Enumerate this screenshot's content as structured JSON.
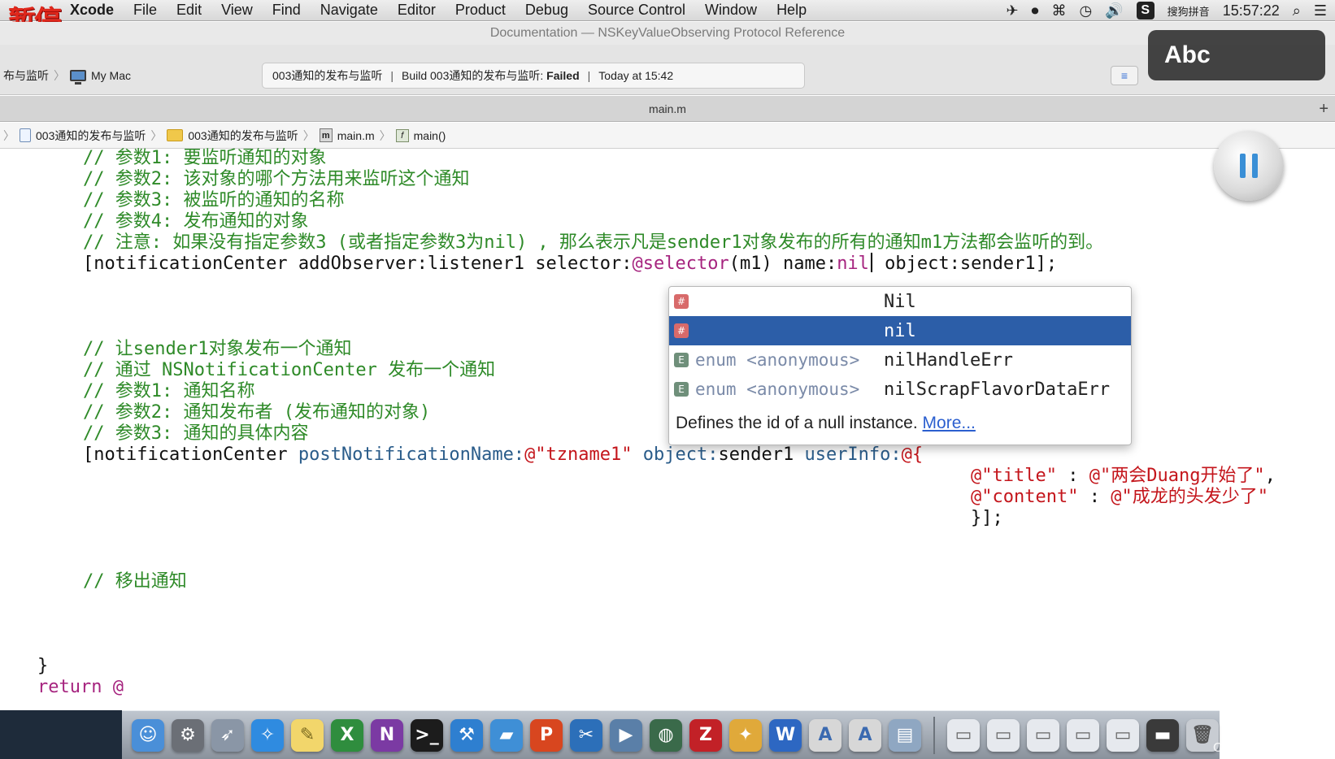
{
  "overlay": {
    "pause_label": "暂停",
    "ime_hud": "Abc"
  },
  "menubar": {
    "app": "Xcode",
    "items": [
      "File",
      "Edit",
      "View",
      "Find",
      "Navigate",
      "Editor",
      "Product",
      "Debug",
      "Source Control",
      "Window",
      "Help"
    ],
    "ime": "搜狗拼音",
    "clock": "15:57:22"
  },
  "window": {
    "title": "Documentation — NSKeyValueObserving Protocol Reference"
  },
  "toolbar": {
    "scheme": "布与监听",
    "destination": "My Mac",
    "activity": {
      "project": "003通知的发布与监听",
      "build_prefix": "Build 003通知的发布与监听:",
      "build_status": "Failed",
      "time": "Today at 15:42"
    }
  },
  "tab": {
    "title": "main.m",
    "add": "+"
  },
  "jumpbar": [
    "003通知的发布与监听",
    "003通知的发布与监听",
    "main.m",
    "main()"
  ],
  "code": {
    "line1": "// 参数1: 要监听通知的对象",
    "line2": "// 参数2: 该对象的哪个方法用来监听这个通知",
    "line3": "// 参数3: 被监听的通知的名称",
    "line4": "// 参数4: 发布通知的对象",
    "line5": "// 注意: 如果没有指定参数3 (或者指定参数3为nil) , 那么表示凡是sender1对象发布的所有的通知m1方法都会监听的到。",
    "line6": {
      "p1": "[notificationCenter addObserver:listener1 selector:",
      "kw": "@selector",
      "p2": "(m1) name:",
      "nil": "nil",
      "p3": " object:sender1];"
    },
    "line7": "// 让sender1对象发布一个通知",
    "line8": "// 通过 NSNotificationCenter 发布一个通知",
    "line9": "// 参数1: 通知名称",
    "line10": "// 参数2: 通知发布者 (发布通知的对象)",
    "line11": "// 参数3: 通知的具体内容",
    "line12": {
      "p1": "[notificationCenter ",
      "m1": "postNotificationName:",
      "s1": "@\"tzname1\"",
      "m2": " object:",
      "p2": "sender1 ",
      "m3": "userInfo:",
      "s2": "@{"
    },
    "line13": {
      "k": "@\"title\"",
      "sep": " : ",
      "v": "@\"两会Duang开始了\"",
      "end": ","
    },
    "line14": {
      "k": "@\"content\"",
      "sep": " : ",
      "v": "@\"成龙的头发少了\""
    },
    "line15": "}];",
    "line16": "// 移出通知",
    "line17": "}",
    "line18": "return @"
  },
  "autocomplete": {
    "items": [
      {
        "type": "",
        "name": "Nil",
        "icon": "#"
      },
      {
        "type": "",
        "name": "nil",
        "icon": "#"
      },
      {
        "type": "enum <anonymous>",
        "name": "nilHandleErr",
        "icon": "E"
      },
      {
        "type": "enum <anonymous>",
        "name": "nilScrapFlavorDataErr",
        "icon": "E"
      }
    ],
    "doc": "Defines the id of a null instance.",
    "more": "More..."
  },
  "watermark": "CSDN @清风清晨"
}
